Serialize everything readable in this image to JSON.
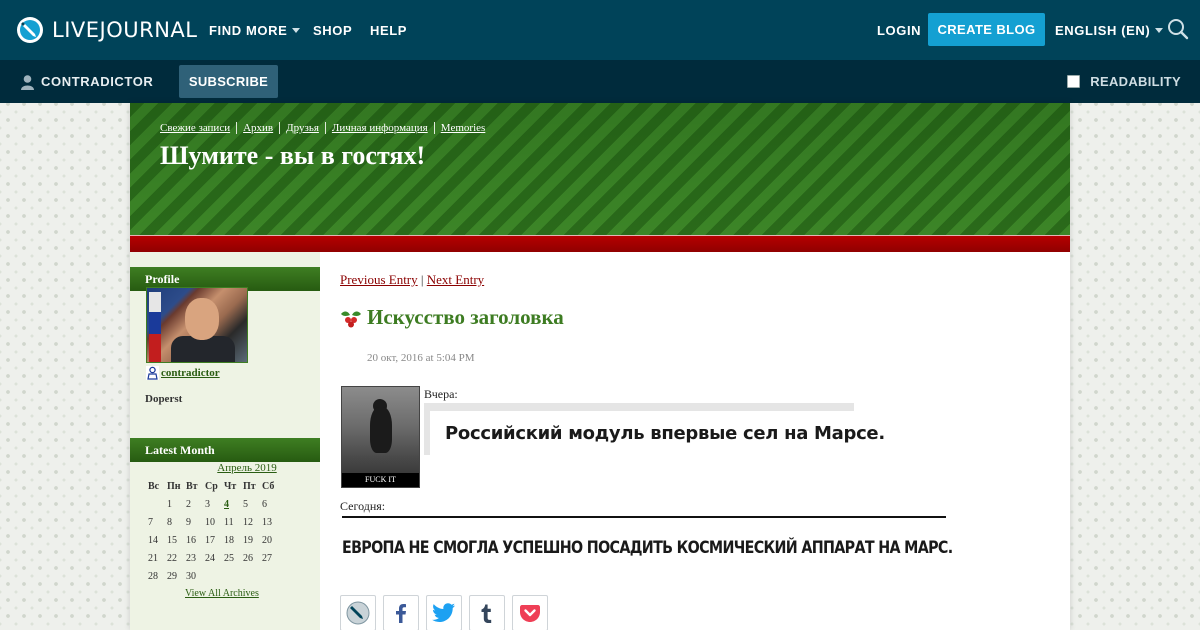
{
  "topbar": {
    "logo_text": "LIVEJOURNAL",
    "find_more": "FIND MORE",
    "shop": "SHOP",
    "help": "HELP",
    "login": "LOGIN",
    "create_blog": "CREATE BLOG",
    "language": "ENGLISH (EN)"
  },
  "subbar": {
    "username": "CONTRADICTOR",
    "subscribe": "SUBSCRIBE",
    "readability": "READABILITY"
  },
  "journal": {
    "nav": [
      "Свежие записи",
      "Архив",
      "Друзья",
      "Личная информация",
      "Memories"
    ],
    "title": "Шумите - вы в гостях!"
  },
  "sidebar": {
    "profile_heading": "Profile",
    "username": "contradictor",
    "subtitle": "Doperst",
    "latest_month_heading": "Latest Month",
    "calendar": {
      "month": "Апрель 2019",
      "weekdays": [
        "Вс",
        "Пн",
        "Вт",
        "Ср",
        "Чт",
        "Пт",
        "Сб"
      ],
      "weeks": [
        [
          "",
          "1",
          "2",
          "3",
          "4",
          "5",
          "6"
        ],
        [
          "7",
          "8",
          "9",
          "10",
          "11",
          "12",
          "13"
        ],
        [
          "14",
          "15",
          "16",
          "17",
          "18",
          "19",
          "20"
        ],
        [
          "21",
          "22",
          "23",
          "24",
          "25",
          "26",
          "27"
        ],
        [
          "28",
          "29",
          "30",
          "",
          "",
          "",
          ""
        ]
      ],
      "linked_day": "4"
    },
    "view_all_archives": "View All Archives"
  },
  "entry": {
    "prev": "Previous Entry",
    "sep": "|",
    "next": "Next Entry",
    "title": "Искусство заголовка",
    "date": "20 окт, 2016 at 5:04 PM",
    "image_caption": "FUCK IT",
    "yesterday_label": "Вчера:",
    "headline_yesterday": "Российский модуль впервые сел на Марсе.",
    "today_label": "Сегодня:",
    "headline_today": "ЕВРОПА НЕ СМОГЛА УСПЕШНО ПОСАДИТЬ КОСМИЧЕСКИЙ АППАРАТ НА МАРС."
  },
  "share_buttons": [
    "livejournal-icon",
    "facebook-icon",
    "twitter-icon",
    "tumblr-icon",
    "pocket-icon"
  ],
  "colors": {
    "topbar": "#004359",
    "subbar": "#002b3c",
    "create_blog": "#14a0d2",
    "header_green": "#2a6a1a",
    "red_band": "#b50000",
    "entry_title": "#3d7c22",
    "entry_link": "#8b0000"
  }
}
